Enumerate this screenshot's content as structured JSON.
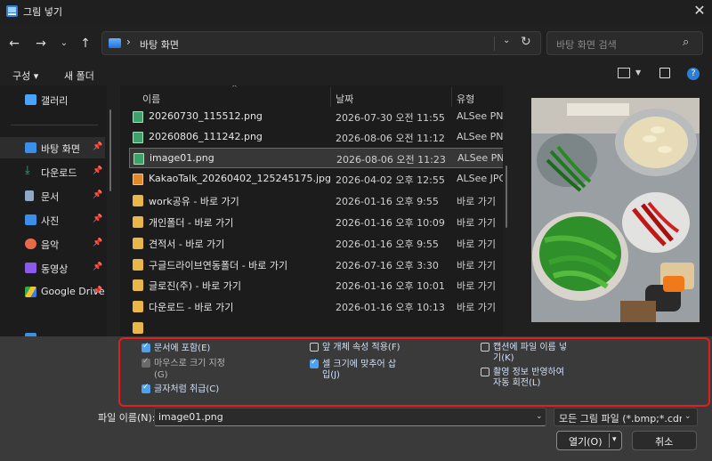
{
  "window": {
    "title": "그림 넣기"
  },
  "address": {
    "location": "바탕 화면"
  },
  "search": {
    "placeholder": "바탕 화면 검색"
  },
  "toolbar": {
    "organize": "구성 ▾",
    "new_folder": "새 폴더"
  },
  "sidebar": {
    "items": [
      {
        "label": "갤러리",
        "icon": "gallery-icon",
        "color": "#4aa3ff"
      },
      {
        "label": "바탕 화면",
        "icon": "desktop-icon",
        "color": "#3b8fe8",
        "selected": true,
        "pinned": true
      },
      {
        "label": "다운로드",
        "icon": "download-icon",
        "color": "#3aaf7a",
        "pinned": true
      },
      {
        "label": "문서",
        "icon": "documents-icon",
        "color": "#8fa8c8",
        "pinned": true
      },
      {
        "label": "사진",
        "icon": "pictures-icon",
        "color": "#3b8fe8",
        "pinned": true
      },
      {
        "label": "음악",
        "icon": "music-icon",
        "color": "#e86a4a",
        "pinned": true
      },
      {
        "label": "동영상",
        "icon": "videos-icon",
        "color": "#8a5ae8",
        "pinned": true
      },
      {
        "label": "Google Drive",
        "icon": "google-drive-icon",
        "color": "#f2c230",
        "pinned": true
      }
    ]
  },
  "filelist": {
    "columns": {
      "name": "이름",
      "date": "날짜",
      "type": "유형"
    },
    "rows": [
      {
        "name": "20260730_115512.png",
        "date": "2026-07-30 오전 11:55",
        "type": "ALSee PNG",
        "kind": "png"
      },
      {
        "name": "20260806_111242.png",
        "date": "2026-08-06 오전 11:12",
        "type": "ALSee PNG",
        "kind": "png"
      },
      {
        "name": "image01.png",
        "date": "2026-08-06 오전 11:23",
        "type": "ALSee PNG",
        "kind": "png",
        "selected": true
      },
      {
        "name": "KakaoTalk_20260402_125245175.jpg",
        "date": "2026-04-02 오후 12:55",
        "type": "ALSee JPG",
        "kind": "jpg"
      },
      {
        "name": "work공유 - 바로 가기",
        "date": "2026-01-16 오후 9:55",
        "type": "바로 가기",
        "kind": "folder"
      },
      {
        "name": "개인폴더 - 바로 가기",
        "date": "2026-01-16 오후 10:09",
        "type": "바로 가기",
        "kind": "folder"
      },
      {
        "name": "견적서 - 바로 가기",
        "date": "2026-01-16 오후 9:55",
        "type": "바로 가기",
        "kind": "folder"
      },
      {
        "name": "구글드라이브연동폴더 - 바로 가기",
        "date": "2026-07-16 오후 3:30",
        "type": "바로 가기",
        "kind": "folder"
      },
      {
        "name": "글로진(주) - 바로 가기",
        "date": "2026-01-16 오후 10:01",
        "type": "바로 가기",
        "kind": "folder"
      },
      {
        "name": "다운로드 - 바로 가기",
        "date": "2026-01-16 오후 10:13",
        "type": "바로 가기",
        "kind": "folder"
      }
    ]
  },
  "options": {
    "link_to_document": {
      "label": "문서에 포함(E)",
      "checked": true
    },
    "mouse_size": {
      "label_line1": "마우스로 크기 지정",
      "label_line2": "(G)",
      "checked": true,
      "disabled": true
    },
    "as_character": {
      "label": "글자처럼 취급(C)",
      "checked": true
    },
    "front_object_props": {
      "label": "앞 개체 속성 적용(F)",
      "checked": false
    },
    "fit_cell": {
      "label_line1": "셀 크기에 맞추어 삽",
      "label_line2": "입(J)",
      "checked": true
    },
    "caption_filename": {
      "label_line1": "캡션에 파일 이름 넣",
      "label_line2": "기(K)",
      "checked": false
    },
    "auto_rotate": {
      "label_line1": "촬영 정보 반영하여",
      "label_line2": "자동 회전(L)",
      "checked": false
    }
  },
  "bottom": {
    "filename_label": "파일 이름(N):",
    "filename_value": "image01.png",
    "filetype_value": "모든 그림 파일 (*.bmp;*.cdr;*.c",
    "open_label": "열기(O)",
    "cancel_label": "취소"
  }
}
